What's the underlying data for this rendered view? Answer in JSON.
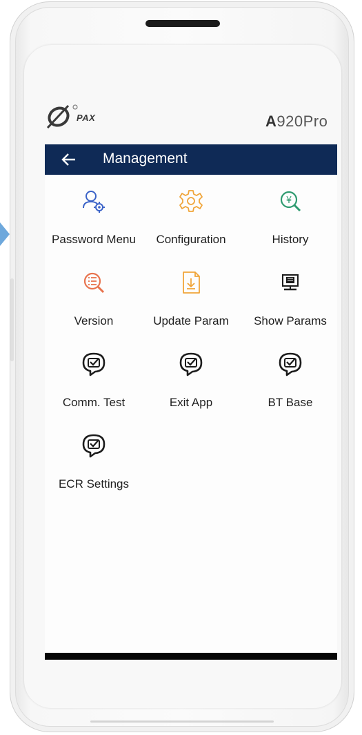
{
  "device": {
    "brand": "PAX",
    "model_prefix": "A",
    "model_suffix": "920Pro"
  },
  "appbar": {
    "title": "Management"
  },
  "colors": {
    "appbar": "#0f2a56",
    "blue_icon": "#3b63c8",
    "orange_icon": "#f0a53a",
    "green_icon": "#2e9a6f",
    "red_icon": "#e8734d",
    "dark_icon": "#1c1c1c"
  },
  "menu": [
    {
      "label": "Password Menu",
      "icon": "user-gear-icon"
    },
    {
      "label": "Configuration",
      "icon": "gear-icon"
    },
    {
      "label": "History",
      "icon": "yen-search-icon"
    },
    {
      "label": "Version",
      "icon": "list-search-icon"
    },
    {
      "label": "Update Param",
      "icon": "file-download-icon"
    },
    {
      "label": "Show Params",
      "icon": "monitor-icon"
    },
    {
      "label": "Comm. Test",
      "icon": "chat-check-icon"
    },
    {
      "label": "Exit App",
      "icon": "chat-check-icon"
    },
    {
      "label": "BT Base",
      "icon": "chat-check-icon"
    },
    {
      "label": "ECR Settings",
      "icon": "chat-check-icon"
    }
  ]
}
